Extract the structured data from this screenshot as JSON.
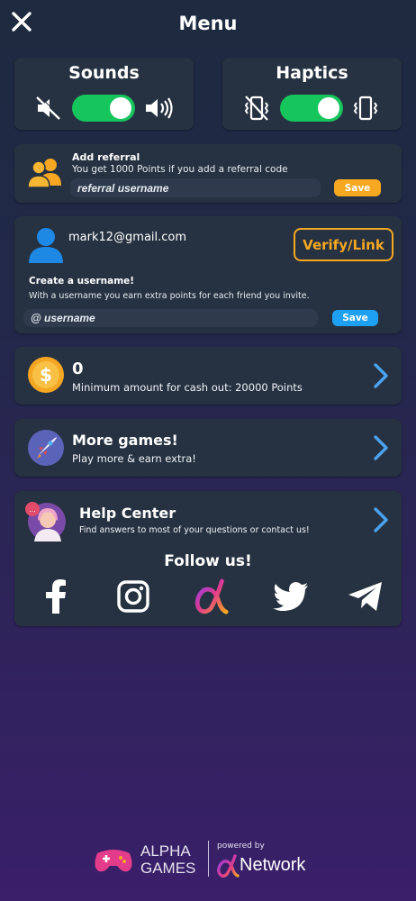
{
  "header": {
    "title": "Menu"
  },
  "sounds": {
    "label": "Sounds",
    "enabled": true
  },
  "haptics": {
    "label": "Haptics",
    "enabled": true
  },
  "referral": {
    "title": "Add referral",
    "subtitle": "You get 1000 Points if you add a referral code",
    "placeholder": "referral username",
    "save_label": "Save"
  },
  "account": {
    "email": "mark12@gmail.com",
    "verify_label": "Verify/Link",
    "create_title": "Create a username!",
    "create_subtitle": "With a username you earn extra points for each friend you invite.",
    "username_placeholder": "@ username",
    "save_label": "Save"
  },
  "points": {
    "value": "0",
    "subtitle": "Minimum amount for cash out: 20000 Points"
  },
  "more_games": {
    "title": "More games!",
    "subtitle": "Play more & earn extra!"
  },
  "help": {
    "title": "Help Center",
    "subtitle": "Find answers to most of your questions or contact us!"
  },
  "follow": {
    "title": "Follow us!",
    "networks": [
      "facebook-icon",
      "instagram-icon",
      "alpha-icon",
      "twitter-icon",
      "telegram-icon"
    ]
  },
  "footer": {
    "brand_line1": "ALPHA",
    "brand_line2": "GAMES",
    "powered_by": "powered by",
    "network": "Network"
  },
  "colors": {
    "toggle_on": "#17c55d",
    "accent_orange": "#f6a821",
    "accent_blue": "#1ea1f2",
    "chevron": "#4aa3f0"
  }
}
